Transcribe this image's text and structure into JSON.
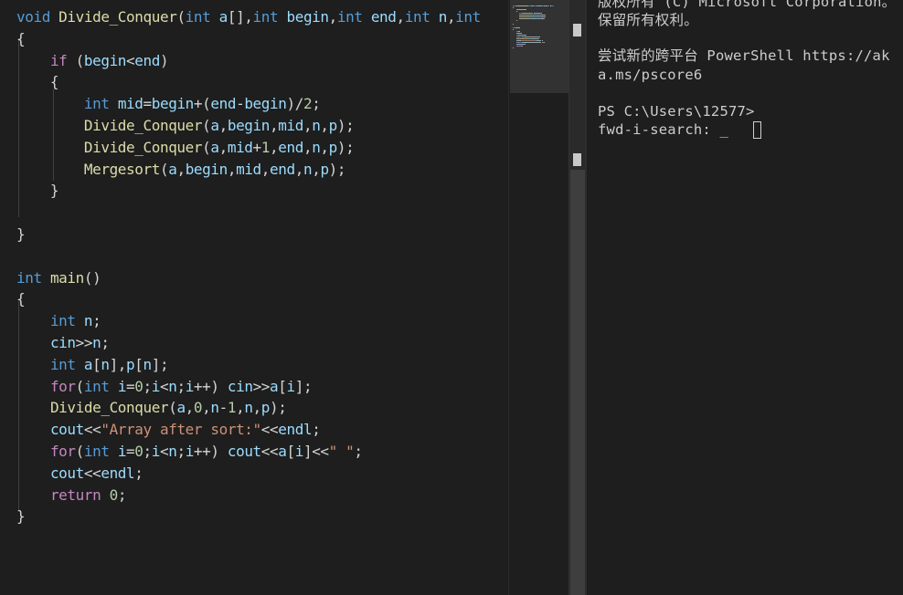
{
  "editor": {
    "lines": [
      [
        [
          "kw",
          "void "
        ],
        [
          "fn",
          "Divide_Conquer"
        ],
        [
          "op",
          "("
        ],
        [
          "kw",
          "int "
        ],
        [
          "id",
          "a"
        ],
        [
          "op",
          "[],"
        ],
        [
          "kw",
          "int "
        ],
        [
          "id",
          "begin"
        ],
        [
          "op",
          ","
        ],
        [
          "kw",
          "int "
        ],
        [
          "id",
          "end"
        ],
        [
          "op",
          ","
        ],
        [
          "kw",
          "int "
        ],
        [
          "id",
          "n"
        ],
        [
          "op",
          ","
        ],
        [
          "kw",
          "int"
        ]
      ],
      [
        [
          "op",
          "{"
        ]
      ],
      [
        [
          "op",
          "    "
        ],
        [
          "ctl",
          "if "
        ],
        [
          "op",
          "("
        ],
        [
          "id",
          "begin"
        ],
        [
          "op",
          "<"
        ],
        [
          "id",
          "end"
        ],
        [
          "op",
          ")"
        ]
      ],
      [
        [
          "op",
          "    {"
        ]
      ],
      [
        [
          "op",
          "        "
        ],
        [
          "kw",
          "int "
        ],
        [
          "id",
          "mid"
        ],
        [
          "op",
          "="
        ],
        [
          "id",
          "begin"
        ],
        [
          "op",
          "+("
        ],
        [
          "id",
          "end"
        ],
        [
          "op",
          "-"
        ],
        [
          "id",
          "begin"
        ],
        [
          "op",
          ")/"
        ],
        [
          "num",
          "2"
        ],
        [
          "op",
          ";"
        ]
      ],
      [
        [
          "op",
          "        "
        ],
        [
          "fn",
          "Divide_Conquer"
        ],
        [
          "op",
          "("
        ],
        [
          "id",
          "a"
        ],
        [
          "op",
          ","
        ],
        [
          "id",
          "begin"
        ],
        [
          "op",
          ","
        ],
        [
          "id",
          "mid"
        ],
        [
          "op",
          ","
        ],
        [
          "id",
          "n"
        ],
        [
          "op",
          ","
        ],
        [
          "id",
          "p"
        ],
        [
          "op",
          ");"
        ]
      ],
      [
        [
          "op",
          "        "
        ],
        [
          "fn",
          "Divide_Conquer"
        ],
        [
          "op",
          "("
        ],
        [
          "id",
          "a"
        ],
        [
          "op",
          ","
        ],
        [
          "id",
          "mid"
        ],
        [
          "op",
          "+"
        ],
        [
          "num",
          "1"
        ],
        [
          "op",
          ","
        ],
        [
          "id",
          "end"
        ],
        [
          "op",
          ","
        ],
        [
          "id",
          "n"
        ],
        [
          "op",
          ","
        ],
        [
          "id",
          "p"
        ],
        [
          "op",
          ");"
        ]
      ],
      [
        [
          "op",
          "        "
        ],
        [
          "fn",
          "Mergesort"
        ],
        [
          "op",
          "("
        ],
        [
          "id",
          "a"
        ],
        [
          "op",
          ","
        ],
        [
          "id",
          "begin"
        ],
        [
          "op",
          ","
        ],
        [
          "id",
          "mid"
        ],
        [
          "op",
          ","
        ],
        [
          "id",
          "end"
        ],
        [
          "op",
          ","
        ],
        [
          "id",
          "n"
        ],
        [
          "op",
          ","
        ],
        [
          "id",
          "p"
        ],
        [
          "op",
          ");"
        ]
      ],
      [
        [
          "op",
          "    }"
        ]
      ],
      [
        [
          "op",
          ""
        ]
      ],
      [
        [
          "op",
          "}"
        ]
      ],
      [
        [
          "op",
          ""
        ]
      ],
      [
        [
          "kw",
          "int "
        ],
        [
          "fn",
          "main"
        ],
        [
          "op",
          "()"
        ]
      ],
      [
        [
          "op",
          "{"
        ]
      ],
      [
        [
          "op",
          "    "
        ],
        [
          "kw",
          "int "
        ],
        [
          "id",
          "n"
        ],
        [
          "op",
          ";"
        ]
      ],
      [
        [
          "op",
          "    "
        ],
        [
          "id",
          "cin"
        ],
        [
          "op",
          ">>"
        ],
        [
          "id",
          "n"
        ],
        [
          "op",
          ";"
        ]
      ],
      [
        [
          "op",
          "    "
        ],
        [
          "kw",
          "int "
        ],
        [
          "id",
          "a"
        ],
        [
          "op",
          "["
        ],
        [
          "id",
          "n"
        ],
        [
          "op",
          "],"
        ],
        [
          "id",
          "p"
        ],
        [
          "op",
          "["
        ],
        [
          "id",
          "n"
        ],
        [
          "op",
          "];"
        ]
      ],
      [
        [
          "op",
          "    "
        ],
        [
          "ctl",
          "for"
        ],
        [
          "op",
          "("
        ],
        [
          "kw",
          "int "
        ],
        [
          "id",
          "i"
        ],
        [
          "op",
          "="
        ],
        [
          "num",
          "0"
        ],
        [
          "op",
          ";"
        ],
        [
          "id",
          "i"
        ],
        [
          "op",
          "<"
        ],
        [
          "id",
          "n"
        ],
        [
          "op",
          ";"
        ],
        [
          "id",
          "i"
        ],
        [
          "op",
          "++) "
        ],
        [
          "id",
          "cin"
        ],
        [
          "op",
          ">>"
        ],
        [
          "id",
          "a"
        ],
        [
          "op",
          "["
        ],
        [
          "id",
          "i"
        ],
        [
          "op",
          "];"
        ]
      ],
      [
        [
          "op",
          "    "
        ],
        [
          "fn",
          "Divide_Conquer"
        ],
        [
          "op",
          "("
        ],
        [
          "id",
          "a"
        ],
        [
          "op",
          ","
        ],
        [
          "num",
          "0"
        ],
        [
          "op",
          ","
        ],
        [
          "id",
          "n"
        ],
        [
          "op",
          "-"
        ],
        [
          "num",
          "1"
        ],
        [
          "op",
          ","
        ],
        [
          "id",
          "n"
        ],
        [
          "op",
          ","
        ],
        [
          "id",
          "p"
        ],
        [
          "op",
          ");"
        ]
      ],
      [
        [
          "op",
          "    "
        ],
        [
          "id",
          "cout"
        ],
        [
          "op",
          "<<"
        ],
        [
          "str",
          "\"Array after sort:\""
        ],
        [
          "op",
          "<<"
        ],
        [
          "id",
          "endl"
        ],
        [
          "op",
          ";"
        ]
      ],
      [
        [
          "op",
          "    "
        ],
        [
          "ctl",
          "for"
        ],
        [
          "op",
          "("
        ],
        [
          "kw",
          "int "
        ],
        [
          "id",
          "i"
        ],
        [
          "op",
          "="
        ],
        [
          "num",
          "0"
        ],
        [
          "op",
          ";"
        ],
        [
          "id",
          "i"
        ],
        [
          "op",
          "<"
        ],
        [
          "id",
          "n"
        ],
        [
          "op",
          ";"
        ],
        [
          "id",
          "i"
        ],
        [
          "op",
          "++) "
        ],
        [
          "id",
          "cout"
        ],
        [
          "op",
          "<<"
        ],
        [
          "id",
          "a"
        ],
        [
          "op",
          "["
        ],
        [
          "id",
          "i"
        ],
        [
          "op",
          "]<<"
        ],
        [
          "str",
          "\" \""
        ],
        [
          "op",
          ";"
        ]
      ],
      [
        [
          "op",
          "    "
        ],
        [
          "id",
          "cout"
        ],
        [
          "op",
          "<<"
        ],
        [
          "id",
          "endl"
        ],
        [
          "op",
          ";"
        ]
      ],
      [
        [
          "op",
          "    "
        ],
        [
          "ctl",
          "return "
        ],
        [
          "num",
          "0"
        ],
        [
          "op",
          ";"
        ]
      ],
      [
        [
          "op",
          "}"
        ]
      ]
    ]
  },
  "terminal": {
    "lines": [
      "版权所有 (C) Microsoft Corporation。",
      "保留所有权利。",
      "",
      "尝试新的跨平台 PowerShell https://ak",
      "a.ms/pscore6",
      "",
      "PS C:\\Users\\12577>",
      "fwd-i-search: _"
    ]
  },
  "colors": {
    "kw": "#569cd6",
    "fn": "#dcdcaa",
    "id": "#9cdcfe",
    "str": "#ce9178",
    "num": "#b5cea8",
    "ctl": "#c586c0",
    "op": "#d4d4d4",
    "background": "#1e1e1e",
    "terminal_text": "#cccccc"
  }
}
